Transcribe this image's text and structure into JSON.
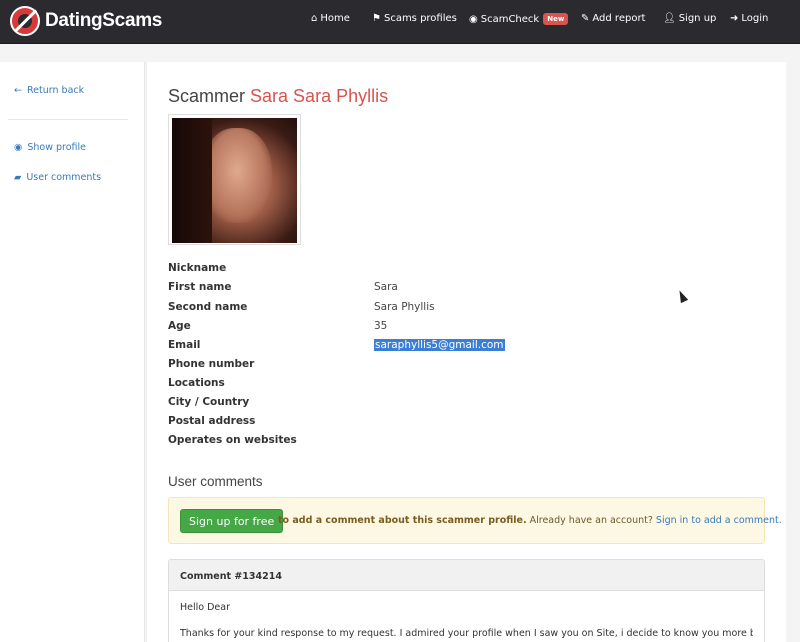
{
  "brand": {
    "name": "DatingScams"
  },
  "nav": {
    "home": "Home",
    "scams_profiles": "Scams profiles",
    "scamcheck": "ScamCheck",
    "scamcheck_badge": "New",
    "add_report": "Add report",
    "sign_up": "Sign up",
    "login": "Login"
  },
  "sidebar": {
    "return_back": "Return back",
    "show_profile": "Show profile",
    "user_comments": "User comments"
  },
  "profile": {
    "title_prefix": "Scammer",
    "name": "Sara Sara Phyllis",
    "fields": [
      {
        "label": "Nickname",
        "value": ""
      },
      {
        "label": "First name",
        "value": "Sara"
      },
      {
        "label": "Second name",
        "value": "Sara Phyllis"
      },
      {
        "label": "Age",
        "value": "35"
      },
      {
        "label": "Email",
        "value": "saraphyllis5@gmail.com"
      },
      {
        "label": "Phone number",
        "value": ""
      },
      {
        "label": "Locations",
        "value": ""
      },
      {
        "label": "City / Country",
        "value": ""
      },
      {
        "label": "Postal address",
        "value": ""
      },
      {
        "label": "Operates on websites",
        "value": ""
      }
    ]
  },
  "comments_section": {
    "title": "User comments",
    "signup_button": "Sign up for free",
    "signup_text": "to add a comment about this scammer profile.",
    "have_account": "Already have an account?",
    "signin_link": "Sign in to add a comment."
  },
  "comment": {
    "header": "Comment #134214",
    "greeting": "Hello Dear",
    "body": "Thanks for your kind response to my request. I admired your profile when I saw you on Site, i decide to know you more believing that"
  },
  "colors": {
    "navbar_bg": "#2b2a2f",
    "accent_red": "#d9534f",
    "link_blue": "#3a7ab8",
    "button_green": "#45a745",
    "alert_bg": "#fcf8e3"
  },
  "icons": {
    "home": "home-icon",
    "flag": "flag-icon",
    "eye": "eye-icon",
    "edit": "edit-icon",
    "user": "user-icon",
    "login": "login-icon",
    "arrow_left": "arrow-left-icon",
    "comment": "comment-icon"
  }
}
